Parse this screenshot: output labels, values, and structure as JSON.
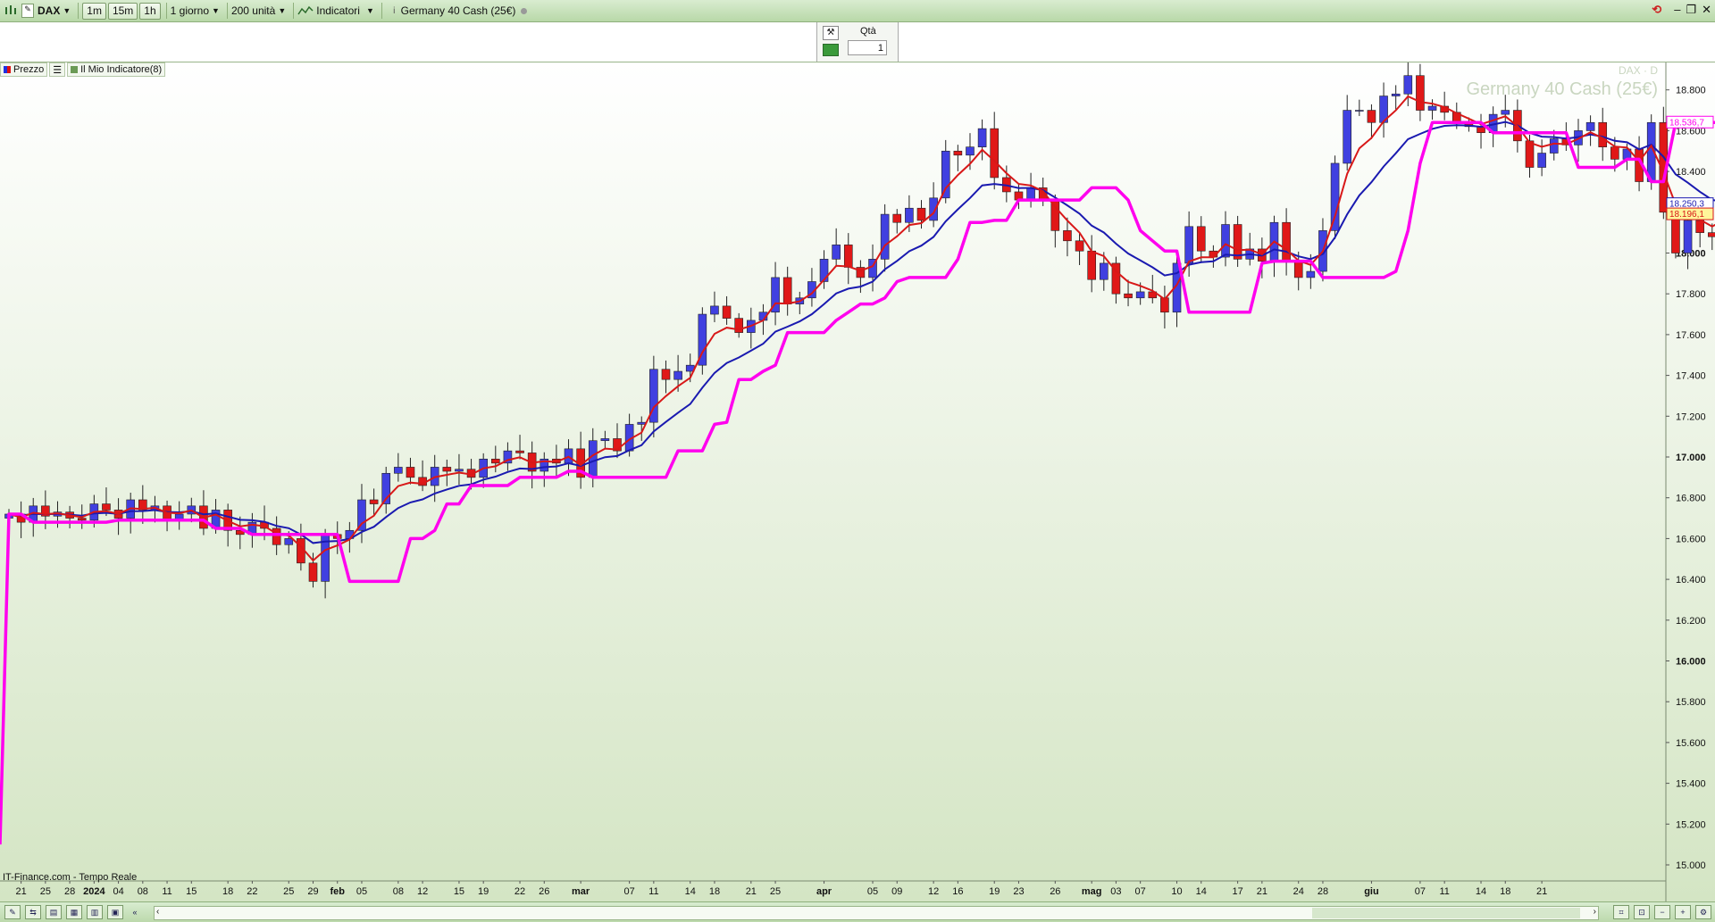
{
  "toolbar": {
    "symbol": "DAX",
    "timeframes": [
      "1m",
      "15m",
      "1h"
    ],
    "period": "1 giorno",
    "units": "200 unità",
    "indicators_label": "Indicatori",
    "instrument": "Germany 40 Cash (25€)"
  },
  "order_panel": {
    "qty_label": "Qtà",
    "qty_value": "1"
  },
  "legend": [
    {
      "label": "Prezzo",
      "color": "#d01010"
    },
    {
      "label": "Il Mio Indicatore(8)",
      "color": "#6b9a55"
    }
  ],
  "watermark": {
    "line1": "DAX · D",
    "line2": "Germany 40 Cash (25€)"
  },
  "footer_note": "IT-Finance.com - Tempo Reale",
  "colors": {
    "up": "#4040e0",
    "down": "#e01818",
    "ema_fast": "#d81818",
    "ema_slow": "#1a1ab0",
    "indicator": "#ff00ee",
    "bg_top": "#ffffff",
    "bg_bottom": "#d4e5c4"
  },
  "price_badges": [
    {
      "value": "18.536,7",
      "color": "#ff00ee"
    },
    {
      "value": "18.250,3",
      "color": "#1a1ab0"
    },
    {
      "value": "18.196,1",
      "color": "#d81818"
    }
  ],
  "chart_data": {
    "type": "candlestick",
    "title": "Germany 40 Cash (25€)",
    "xlabel": "",
    "ylabel": "",
    "ylim": [
      14950,
      18950
    ],
    "y_ticks": [
      15000,
      15200,
      15400,
      15600,
      15800,
      16000,
      16200,
      16400,
      16600,
      16800,
      17000,
      17200,
      17400,
      17600,
      17800,
      18000,
      18200,
      18400,
      18600,
      18800
    ],
    "y_tick_labels": [
      "15.000",
      "15.200",
      "15.400",
      "15.600",
      "15.800",
      "16.000",
      "16.200",
      "16.400",
      "16.600",
      "16.800",
      "17.000",
      "17.200",
      "17.400",
      "17.600",
      "17.800",
      "18.000",
      "18.200",
      "18.400",
      "18.600",
      "18.800"
    ],
    "y_bold": [
      16000,
      17000,
      18000
    ],
    "x_ticks": [
      {
        "i": 1,
        "label": "21"
      },
      {
        "i": 3,
        "label": "25"
      },
      {
        "i": 5,
        "label": "28"
      },
      {
        "i": 7,
        "label": "2024",
        "bold": true
      },
      {
        "i": 9,
        "label": "04"
      },
      {
        "i": 11,
        "label": "08"
      },
      {
        "i": 13,
        "label": "11"
      },
      {
        "i": 15,
        "label": "15"
      },
      {
        "i": 18,
        "label": "18"
      },
      {
        "i": 20,
        "label": "22"
      },
      {
        "i": 23,
        "label": "25"
      },
      {
        "i": 25,
        "label": "29"
      },
      {
        "i": 27,
        "label": "feb",
        "bold": true
      },
      {
        "i": 29,
        "label": "05"
      },
      {
        "i": 32,
        "label": "08"
      },
      {
        "i": 34,
        "label": "12"
      },
      {
        "i": 37,
        "label": "15"
      },
      {
        "i": 39,
        "label": "19"
      },
      {
        "i": 42,
        "label": "22"
      },
      {
        "i": 44,
        "label": "26"
      },
      {
        "i": 47,
        "label": "mar",
        "bold": true
      },
      {
        "i": 51,
        "label": "07"
      },
      {
        "i": 53,
        "label": "11"
      },
      {
        "i": 56,
        "label": "14"
      },
      {
        "i": 58,
        "label": "18"
      },
      {
        "i": 61,
        "label": "21"
      },
      {
        "i": 63,
        "label": "25"
      },
      {
        "i": 67,
        "label": "apr",
        "bold": true
      },
      {
        "i": 71,
        "label": "05"
      },
      {
        "i": 73,
        "label": "09"
      },
      {
        "i": 76,
        "label": "12"
      },
      {
        "i": 78,
        "label": "16"
      },
      {
        "i": 81,
        "label": "19"
      },
      {
        "i": 83,
        "label": "23"
      },
      {
        "i": 86,
        "label": "26"
      },
      {
        "i": 89,
        "label": "mag",
        "bold": true
      },
      {
        "i": 91,
        "label": "03"
      },
      {
        "i": 93,
        "label": "07"
      },
      {
        "i": 96,
        "label": "10"
      },
      {
        "i": 98,
        "label": "14"
      },
      {
        "i": 101,
        "label": "17"
      },
      {
        "i": 103,
        "label": "21"
      },
      {
        "i": 106,
        "label": "24"
      },
      {
        "i": 108,
        "label": "28"
      },
      {
        "i": 112,
        "label": "giu",
        "bold": true
      },
      {
        "i": 116,
        "label": "07"
      },
      {
        "i": 118,
        "label": "11"
      },
      {
        "i": 121,
        "label": "14"
      },
      {
        "i": 123,
        "label": "18"
      },
      {
        "i": 126,
        "label": "21"
      }
    ],
    "series": [
      {
        "name": "Prezzo",
        "kind": "ohlc",
        "close": [
          16720,
          16680,
          16760,
          16710,
          16730,
          16700,
          16690,
          16770,
          16740,
          16700,
          16790,
          16740,
          16760,
          16690,
          16720,
          16760,
          16650,
          16740,
          16640,
          16620,
          16680,
          16650,
          16570,
          16600,
          16480,
          16390,
          16620,
          16600,
          16640,
          16790,
          16770,
          16920,
          16950,
          16900,
          16860,
          16950,
          16930,
          16940,
          16900,
          16990,
          16970,
          17030,
          17020,
          16930,
          16990,
          16970,
          17040,
          16900,
          17080,
          17090,
          17030,
          17160,
          17170,
          17430,
          17380,
          17420,
          17450,
          17700,
          17740,
          17680,
          17610,
          17670,
          17710,
          17880,
          17750,
          17780,
          17860,
          17970,
          18040,
          17930,
          17880,
          17970,
          18190,
          18150,
          18220,
          18160,
          18270,
          18500,
          18480,
          18520,
          18610,
          18370,
          18300,
          18260,
          18320,
          18260,
          18110,
          18060,
          18010,
          17870,
          17950,
          17800,
          17780,
          17810,
          17780,
          17710,
          17950,
          18130,
          18010,
          17980,
          18140,
          17970,
          18020,
          17960,
          18150,
          17960,
          17880,
          17910,
          18110,
          18440,
          18700,
          18700,
          18640,
          18770,
          18780,
          18870,
          18700,
          18720,
          18690,
          18640,
          18620,
          18590,
          18680,
          18700,
          18550,
          18420,
          18490,
          18560,
          18530,
          18600,
          18640,
          18520,
          18460,
          18510,
          18350,
          18640,
          18200,
          18000,
          18160,
          18100,
          18080,
          18210,
          18190
        ]
      }
    ]
  }
}
